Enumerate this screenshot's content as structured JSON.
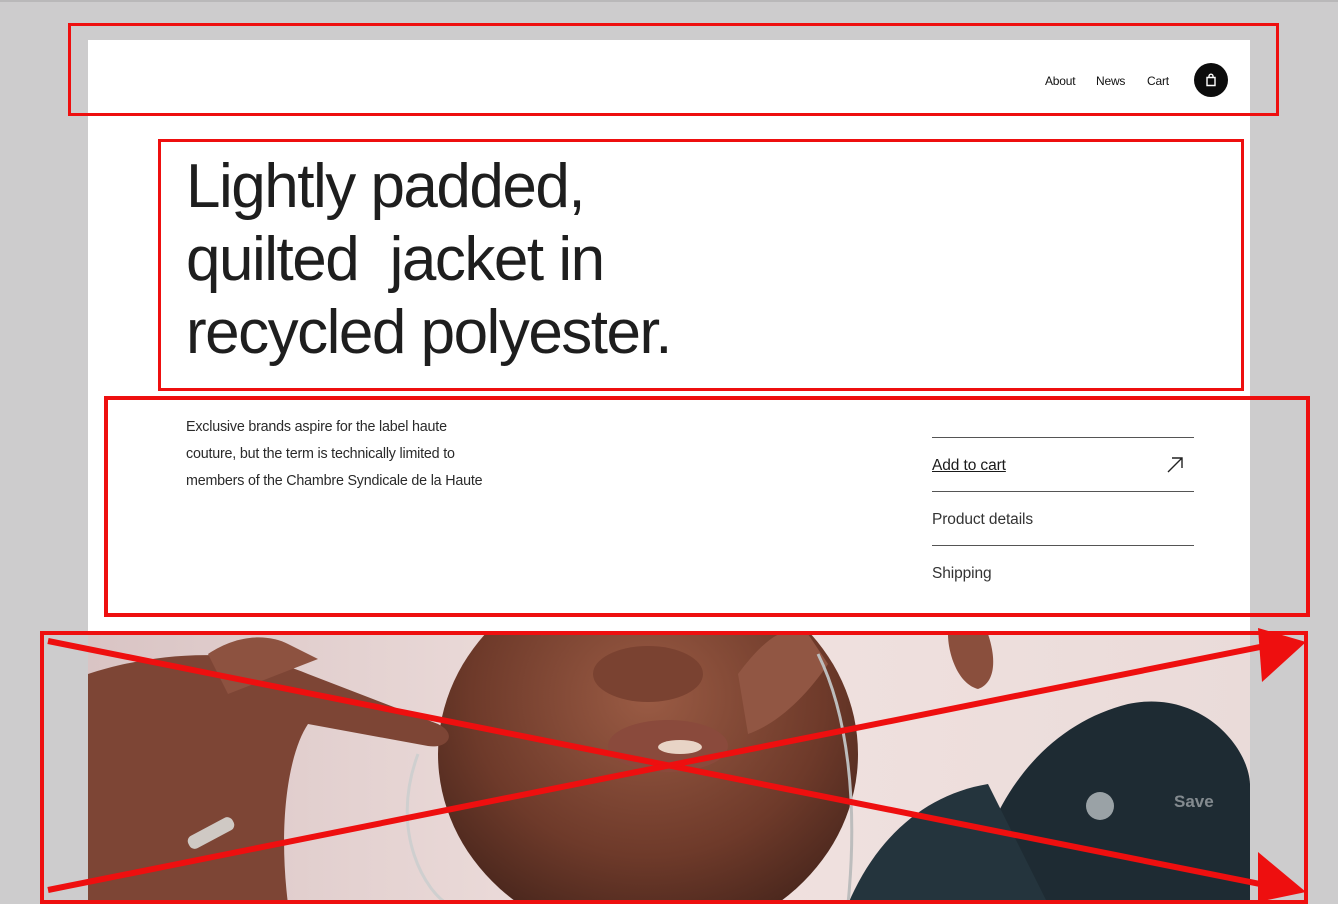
{
  "nav": {
    "about": "About",
    "news": "News",
    "cart": "Cart",
    "cart_icon": "shopping-bag-icon"
  },
  "hero": {
    "line1": "Lightly padded,",
    "line2": "quilted  jacket in",
    "line3": "recycled polyester."
  },
  "description": {
    "line1": "Exclusive brands aspire for the label haute",
    "line2": "couture, but the term is technically limited to",
    "line3": "members of the Chambre Syndicale de la Haute"
  },
  "accordion": {
    "add_to_cart": "Add to cart",
    "add_to_cart_icon": "arrow-up-right-icon",
    "product_details": "Product details",
    "shipping": "Shipping"
  },
  "image": {
    "save_label": "Save"
  },
  "colors": {
    "backdrop": "#cdcccd",
    "annotation": "#ee0f0f",
    "cart_button": "#0c0c0c"
  }
}
